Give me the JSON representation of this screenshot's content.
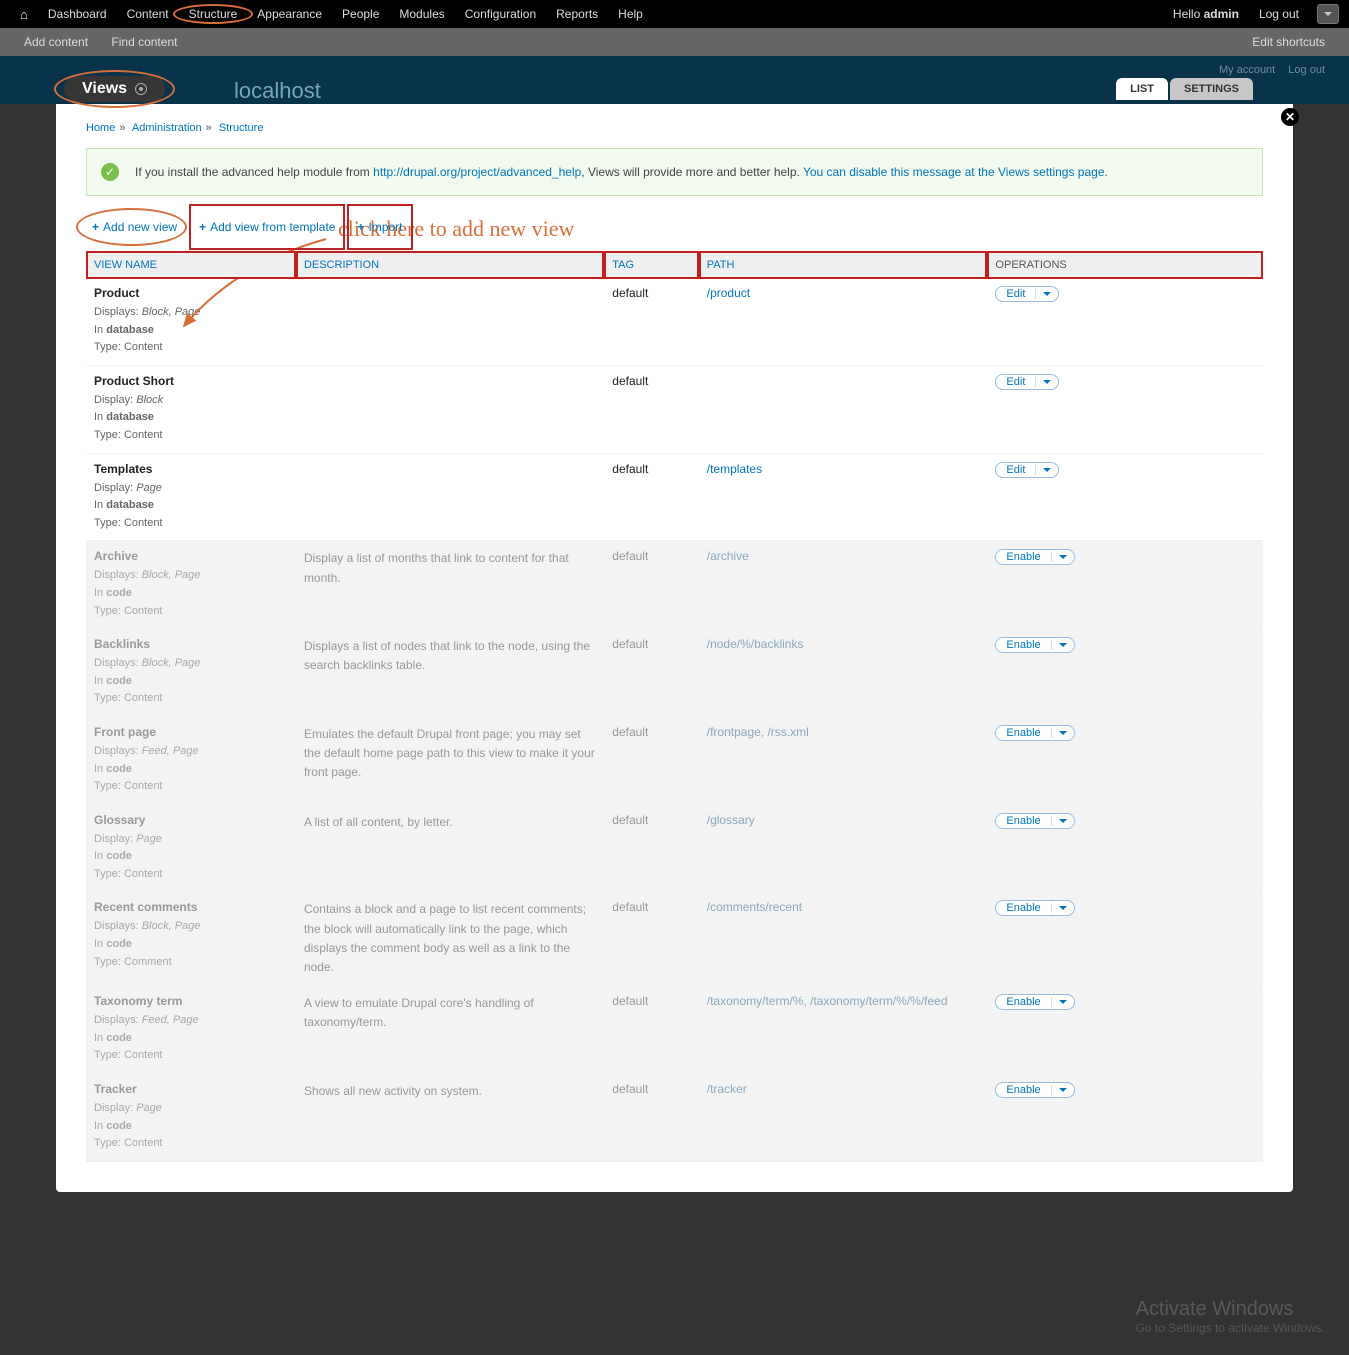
{
  "topbar": {
    "items": [
      "Dashboard",
      "Content",
      "Structure",
      "Appearance",
      "People",
      "Modules",
      "Configuration",
      "Reports",
      "Help"
    ],
    "hello_prefix": "Hello ",
    "user": "admin",
    "logout": "Log out"
  },
  "subbar": {
    "add": "Add content",
    "find": "Find content",
    "edit": "Edit shortcuts"
  },
  "header": {
    "site": "localhost",
    "my_account": "My account",
    "logout": "Log out"
  },
  "overlay": {
    "title": "Views",
    "tabs": [
      "LIST",
      "SETTINGS"
    ],
    "breadcrumb": [
      "Home",
      "Administration",
      "Structure"
    ],
    "help": {
      "pre": "If you install the advanced help module from ",
      "link1": "http://drupal.org/project/advanced_help",
      "mid": ", Views will provide more and better help. ",
      "link2": "You can disable this message at the Views settings page",
      "post": "."
    },
    "actions": {
      "add": "Add new view",
      "template": "Add view from template",
      "import": "Import"
    },
    "callout": "click here to add new view",
    "columns": {
      "name": "VIEW NAME",
      "desc": "DESCRIPTION",
      "tag": "TAG",
      "path": "PATH",
      "ops": "OPERATIONS"
    },
    "ops": {
      "edit": "Edit",
      "enable": "Enable"
    },
    "rows": [
      {
        "enabled": true,
        "name": "Product",
        "displays_label": "Displays:",
        "displays": "Block, Page",
        "storage": "In database",
        "type_label": "Type:",
        "type": "Content",
        "desc": "",
        "tag": "default",
        "path": "/product",
        "op": "edit"
      },
      {
        "enabled": true,
        "name": "Product Short",
        "displays_label": "Display:",
        "displays": "Block",
        "storage": "In database",
        "type_label": "Type:",
        "type": "Content",
        "desc": "",
        "tag": "default",
        "path": "",
        "op": "edit"
      },
      {
        "enabled": true,
        "name": "Templates",
        "displays_label": "Display:",
        "displays": "Page",
        "storage": "In database",
        "type_label": "Type:",
        "type": "Content",
        "desc": "",
        "tag": "default",
        "path": "/templates",
        "op": "edit"
      },
      {
        "enabled": false,
        "name": "Archive",
        "displays_label": "Displays:",
        "displays": "Block, Page",
        "storage": "In code",
        "type_label": "Type:",
        "type": "Content",
        "desc": "Display a list of months that link to content for that month.",
        "tag": "default",
        "path": "/archive",
        "op": "enable"
      },
      {
        "enabled": false,
        "name": "Backlinks",
        "displays_label": "Displays:",
        "displays": "Block, Page",
        "storage": "In code",
        "type_label": "Type:",
        "type": "Content",
        "desc": "Displays a list of nodes that link to the node, using the search backlinks table.",
        "tag": "default",
        "path": "/node/%/backlinks",
        "op": "enable"
      },
      {
        "enabled": false,
        "name": "Front page",
        "displays_label": "Displays:",
        "displays": "Feed, Page",
        "storage": "In code",
        "type_label": "Type:",
        "type": "Content",
        "desc": "Emulates the default Drupal front page; you may set the default home page path to this view to make it your front page.",
        "tag": "default",
        "path": "/frontpage, /rss.xml",
        "op": "enable"
      },
      {
        "enabled": false,
        "name": "Glossary",
        "displays_label": "Display:",
        "displays": "Page",
        "storage": "In code",
        "type_label": "Type:",
        "type": "Content",
        "desc": "A list of all content, by letter.",
        "tag": "default",
        "path": "/glossary",
        "op": "enable"
      },
      {
        "enabled": false,
        "name": "Recent comments",
        "displays_label": "Displays:",
        "displays": "Block, Page",
        "storage": "In code",
        "type_label": "Type:",
        "type": "Comment",
        "desc": "Contains a block and a page to list recent comments; the block will automatically link to the page, which displays the comment body as well as a link to the node.",
        "tag": "default",
        "path": "/comments/recent",
        "op": "enable"
      },
      {
        "enabled": false,
        "name": "Taxonomy term",
        "displays_label": "Displays:",
        "displays": "Feed, Page",
        "storage": "In code",
        "type_label": "Type:",
        "type": "Content",
        "desc": "A view to emulate Drupal core's handling of taxonomy/term.",
        "tag": "default",
        "path": "/taxonomy/term/%, /taxonomy/term/%/%/feed",
        "op": "enable"
      },
      {
        "enabled": false,
        "name": "Tracker",
        "displays_label": "Display:",
        "displays": "Page",
        "storage": "In code",
        "type_label": "Type:",
        "type": "Content",
        "desc": "Shows all new activity on system.",
        "tag": "default",
        "path": "/tracker",
        "op": "enable"
      }
    ]
  },
  "watermark": {
    "t1": "Activate Windows",
    "t2": "Go to Settings to activate Windows."
  }
}
